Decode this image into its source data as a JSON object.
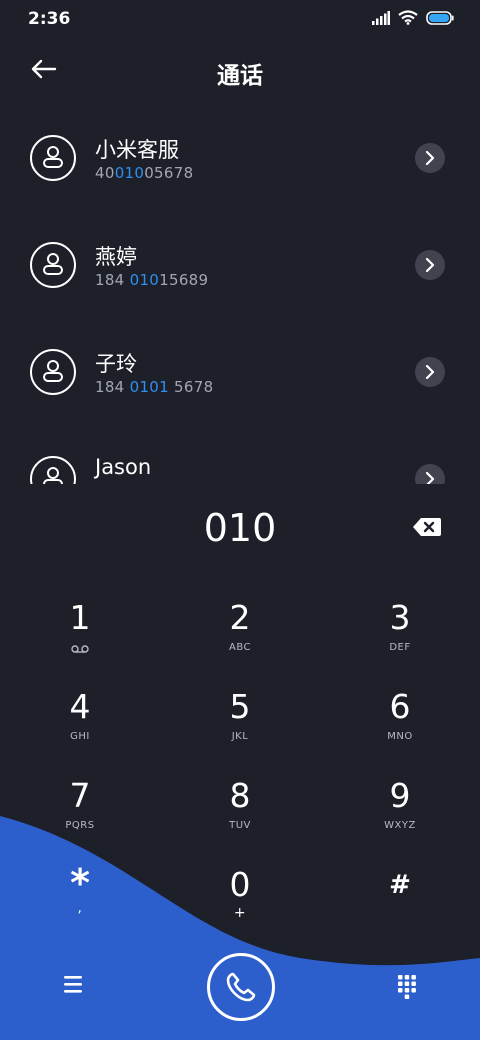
{
  "status_bar": {
    "time": "2:36"
  },
  "header": {
    "title": "通话"
  },
  "contacts": [
    {
      "name": "小米客服",
      "number_pre": "40",
      "number_match": "010",
      "number_post": "05678"
    },
    {
      "name": "燕婷",
      "number_pre": "184 ",
      "number_match": "010",
      "number_post": "15689"
    },
    {
      "name": "子玲",
      "number_pre": "184 ",
      "number_match": "0101",
      "number_post": " 5678"
    },
    {
      "name": "Jason",
      "number_pre": "",
      "number_match": "",
      "number_post": ""
    }
  ],
  "dial_input": "010",
  "keypad": [
    {
      "digit": "1",
      "letters": ""
    },
    {
      "digit": "2",
      "letters": "ABC"
    },
    {
      "digit": "3",
      "letters": "DEF"
    },
    {
      "digit": "4",
      "letters": "GHI"
    },
    {
      "digit": "5",
      "letters": "JKL"
    },
    {
      "digit": "6",
      "letters": "MNO"
    },
    {
      "digit": "7",
      "letters": "PQRS"
    },
    {
      "digit": "8",
      "letters": "TUV"
    },
    {
      "digit": "9",
      "letters": "WXYZ"
    },
    {
      "digit": "*",
      "letters": ","
    },
    {
      "digit": "0",
      "letters": "+"
    },
    {
      "digit": "#",
      "letters": ""
    }
  ],
  "icons": {
    "back": "arrow-left-icon",
    "contact": "person-icon",
    "detail": "chevron-right-icon",
    "backspace": "backspace-icon",
    "voicemail": "voicemail-icon",
    "menu": "menu-icon",
    "call": "phone-icon",
    "dialpad": "dialpad-icon"
  },
  "colors": {
    "background": "#1d1f29",
    "accent_wave": "#2d5fcc",
    "match_highlight": "#2f8ff0",
    "secondary_text": "#a3a6b0"
  }
}
